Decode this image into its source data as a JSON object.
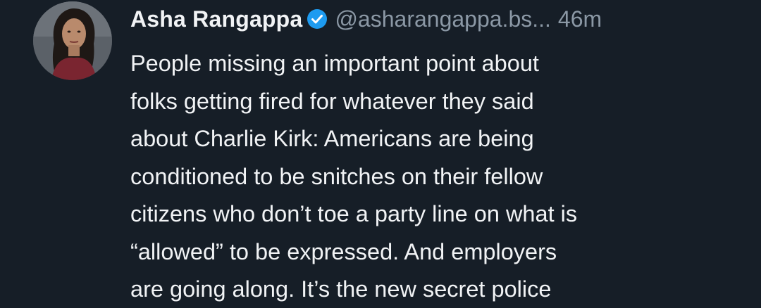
{
  "post": {
    "author": {
      "display_name": "Asha Rangappa",
      "handle": "@asharangappa.bs...",
      "verified": true,
      "avatar": "profile-photo"
    },
    "timestamp": "46m",
    "text_lines": [
      "People missing an important point about",
      "folks getting fired for whatever they said",
      "about Charlie Kirk: Americans are being",
      "conditioned to be snitches on their fellow",
      "citizens who don’t toe a party line on what is",
      "“allowed” to be expressed. And employers",
      "are going along. It’s the new secret police"
    ]
  },
  "colors": {
    "background": "#161e27",
    "text_primary": "#f1f3f5",
    "text_secondary": "#8b98a5",
    "verified_badge": "#1d9bf0"
  },
  "icons": {
    "verified": "verified-check-icon"
  }
}
